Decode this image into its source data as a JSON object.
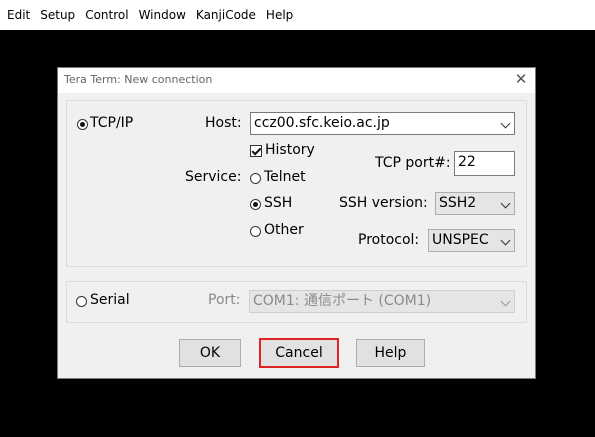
{
  "menubar": {
    "items": [
      "Edit",
      "Setup",
      "Control",
      "Window",
      "KanjiCode",
      "Help"
    ]
  },
  "dialog": {
    "title": "Tera Term: New connection",
    "tcpip": {
      "radio_label": "TCP/IP",
      "selected": true,
      "host_label": "Host:",
      "host_value": "ccz00.sfc.keio.ac.jp",
      "history_label": "History",
      "history_checked": true,
      "service_label": "Service:",
      "services": {
        "telnet": "Telnet",
        "ssh": "SSH",
        "other": "Other"
      },
      "selected_service": "SSH",
      "tcp_port_label": "TCP port#:",
      "tcp_port_value": "22",
      "ssh_version_label": "SSH version:",
      "ssh_version_value": "SSH2",
      "protocol_label": "Protocol:",
      "protocol_value": "UNSPEC"
    },
    "serial": {
      "radio_label": "Serial",
      "selected": false,
      "port_label": "Port:",
      "port_value": "COM1: 通信ポート (COM1)"
    },
    "buttons": {
      "ok": "OK",
      "cancel": "Cancel",
      "help": "Help"
    }
  },
  "colors": {
    "focus_border": "#e02424",
    "dialog_bg": "#f0f0f0",
    "terminal_bg": "#000000"
  }
}
